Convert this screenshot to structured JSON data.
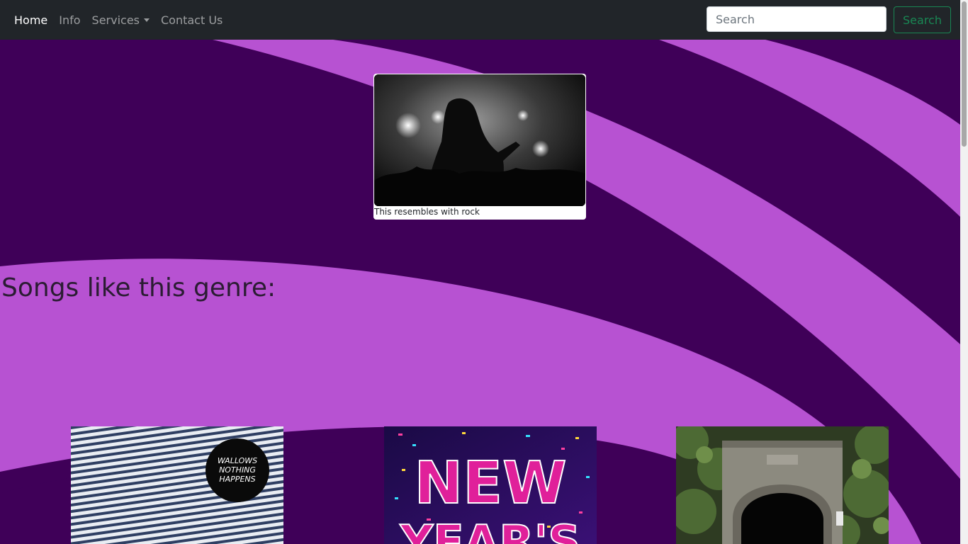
{
  "navbar": {
    "items": [
      {
        "label": "Home"
      },
      {
        "label": "Info"
      },
      {
        "label": "Services"
      },
      {
        "label": "Contact Us"
      }
    ],
    "search": {
      "placeholder": "Search",
      "button_label": "Search"
    }
  },
  "hero": {
    "caption": "This resembles with rock"
  },
  "songs": {
    "heading": "Songs like this genre:",
    "albums": [
      {
        "cover_text": [
          "WALLOWS",
          "NOTHING",
          "HAPPENS"
        ]
      },
      {
        "cover_text": [
          "NEW",
          "YEAR'S"
        ]
      },
      {
        "cover_text": []
      }
    ]
  },
  "colors": {
    "navbar_bg": "#212529",
    "swirl_dark": "#3f0058",
    "swirl_light": "#b752d2",
    "search_button": "#198754"
  }
}
